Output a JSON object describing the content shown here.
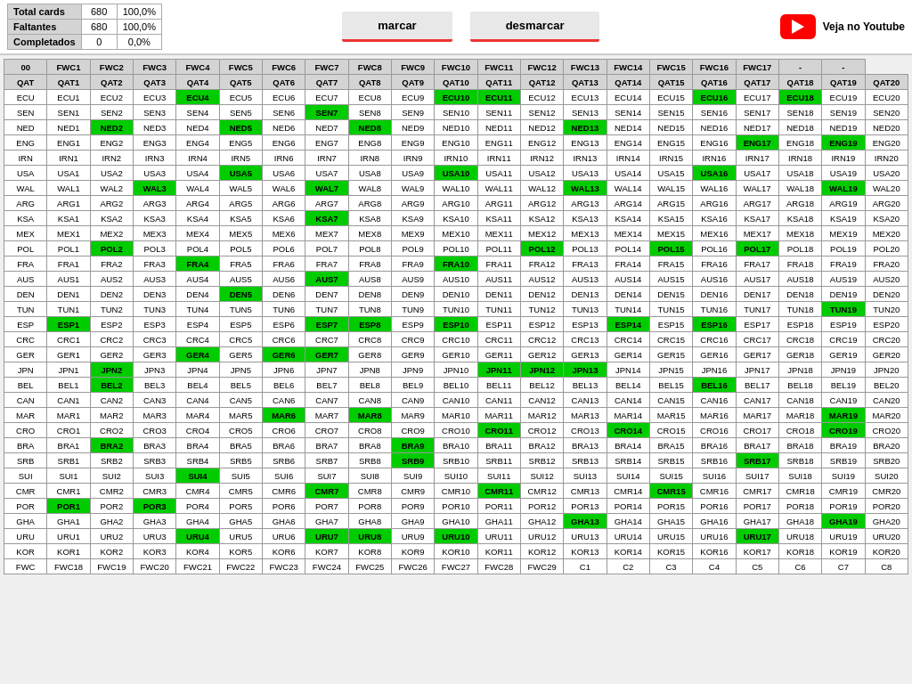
{
  "stats": {
    "total_label": "Total cards",
    "total_value": "680",
    "total_pct": "100,0%",
    "faltantes_label": "Faltantes",
    "faltantes_value": "680",
    "faltantes_pct": "100,0%",
    "completados_label": "Completados",
    "completados_value": "0",
    "completados_pct": "0,0%"
  },
  "buttons": {
    "marcar": "marcar",
    "desmarcar": "desmarcar"
  },
  "youtube": {
    "label": "Veja no Youtube"
  },
  "grid": {
    "headers": [
      "00",
      "FWC1",
      "FWC2",
      "FWC3",
      "FWC4",
      "FWC5",
      "FWC6",
      "FWC7",
      "FWC8",
      "FWC9",
      "FWC10",
      "FWC11",
      "FWC12",
      "FWC13",
      "FWC14",
      "FWC15",
      "FWC16",
      "FWC17",
      "-",
      "-"
    ],
    "rows": [
      {
        "prefix": "QAT",
        "cells": [
          "QAT1",
          "QAT2",
          "QAT3",
          "QAT4",
          "QAT5",
          "QAT6",
          "QAT7",
          "QAT8",
          "QAT9",
          "QAT10",
          "QAT11",
          "QAT12",
          "QAT13",
          "QAT14",
          "QAT15",
          "QAT16",
          "QAT17",
          "QAT18",
          "QAT19",
          "QAT20"
        ],
        "green": [
          13
        ]
      },
      {
        "prefix": "ECU",
        "cells": [
          "ECU1",
          "ECU2",
          "ECU3",
          "ECU4",
          "ECU5",
          "ECU6",
          "ECU7",
          "ECU8",
          "ECU9",
          "ECU10",
          "ECU11",
          "ECU12",
          "ECU13",
          "ECU14",
          "ECU15",
          "ECU16",
          "ECU17",
          "ECU18",
          "ECU19",
          "ECU20"
        ],
        "green": [
          3,
          9,
          10,
          15,
          17
        ]
      },
      {
        "prefix": "SEN",
        "cells": [
          "SEN1",
          "SEN2",
          "SEN3",
          "SEN4",
          "SEN5",
          "SEN6",
          "SEN7",
          "SEN8",
          "SEN9",
          "SEN10",
          "SEN11",
          "SEN12",
          "SEN13",
          "SEN14",
          "SEN15",
          "SEN16",
          "SEN17",
          "SEN18",
          "SEN19",
          "SEN20"
        ],
        "green": [
          6
        ]
      },
      {
        "prefix": "NED",
        "cells": [
          "NED1",
          "NED2",
          "NED3",
          "NED4",
          "NED5",
          "NED6",
          "NED7",
          "NED8",
          "NED9",
          "NED10",
          "NED11",
          "NED12",
          "NED13",
          "NED14",
          "NED15",
          "NED16",
          "NED17",
          "NED18",
          "NED19",
          "NED20"
        ],
        "green": [
          1,
          4,
          7,
          12
        ]
      },
      {
        "prefix": "ENG",
        "cells": [
          "ENG1",
          "ENG2",
          "ENG3",
          "ENG4",
          "ENG5",
          "ENG6",
          "ENG7",
          "ENG8",
          "ENG9",
          "ENG10",
          "ENG11",
          "ENG12",
          "ENG13",
          "ENG14",
          "ENG15",
          "ENG16",
          "ENG17",
          "ENG18",
          "ENG19",
          "ENG20"
        ],
        "green": [
          16,
          18
        ]
      },
      {
        "prefix": "IRN",
        "cells": [
          "IRN1",
          "IRN2",
          "IRN3",
          "IRN4",
          "IRN5",
          "IRN6",
          "IRN7",
          "IRN8",
          "IRN9",
          "IRN10",
          "IRN11",
          "IRN12",
          "IRN13",
          "IRN14",
          "IRN15",
          "IRN16",
          "IRN17",
          "IRN18",
          "IRN19",
          "IRN20"
        ],
        "green": []
      },
      {
        "prefix": "USA",
        "cells": [
          "USA1",
          "USA2",
          "USA3",
          "USA4",
          "USA5",
          "USA6",
          "USA7",
          "USA8",
          "USA9",
          "USA10",
          "USA11",
          "USA12",
          "USA13",
          "USA14",
          "USA15",
          "USA16",
          "USA17",
          "USA18",
          "USA19",
          "USA20"
        ],
        "green": [
          4,
          9,
          15
        ]
      },
      {
        "prefix": "WAL",
        "cells": [
          "WAL1",
          "WAL2",
          "WAL3",
          "WAL4",
          "WAL5",
          "WAL6",
          "WAL7",
          "WAL8",
          "WAL9",
          "WAL10",
          "WAL11",
          "WAL12",
          "WAL13",
          "WAL14",
          "WAL15",
          "WAL16",
          "WAL17",
          "WAL18",
          "WAL19",
          "WAL20"
        ],
        "green": [
          2,
          6,
          12,
          18
        ]
      },
      {
        "prefix": "ARG",
        "cells": [
          "ARG1",
          "ARG2",
          "ARG3",
          "ARG4",
          "ARG5",
          "ARG6",
          "ARG7",
          "ARG8",
          "ARG9",
          "ARG10",
          "ARG11",
          "ARG12",
          "ARG13",
          "ARG14",
          "ARG15",
          "ARG16",
          "ARG17",
          "ARG18",
          "ARG19",
          "ARG20"
        ],
        "green": []
      },
      {
        "prefix": "KSA",
        "cells": [
          "KSA1",
          "KSA2",
          "KSA3",
          "KSA4",
          "KSA5",
          "KSA6",
          "KSA7",
          "KSA8",
          "KSA9",
          "KSA10",
          "KSA11",
          "KSA12",
          "KSA13",
          "KSA14",
          "KSA15",
          "KSA16",
          "KSA17",
          "KSA18",
          "KSA19",
          "KSA20"
        ],
        "green": [
          6
        ]
      },
      {
        "prefix": "MEX",
        "cells": [
          "MEX1",
          "MEX2",
          "MEX3",
          "MEX4",
          "MEX5",
          "MEX6",
          "MEX7",
          "MEX8",
          "MEX9",
          "MEX10",
          "MEX11",
          "MEX12",
          "MEX13",
          "MEX14",
          "MEX15",
          "MEX16",
          "MEX17",
          "MEX18",
          "MEX19",
          "MEX20"
        ],
        "green": []
      },
      {
        "prefix": "POL",
        "cells": [
          "POL1",
          "POL2",
          "POL3",
          "POL4",
          "POL5",
          "POL6",
          "POL7",
          "POL8",
          "POL9",
          "POL10",
          "POL11",
          "POL12",
          "POL13",
          "POL14",
          "POL15",
          "POL16",
          "POL17",
          "POL18",
          "POL19",
          "POL20"
        ],
        "green": [
          1,
          11,
          14,
          16
        ]
      },
      {
        "prefix": "FRA",
        "cells": [
          "FRA1",
          "FRA2",
          "FRA3",
          "FRA4",
          "FRA5",
          "FRA6",
          "FRA7",
          "FRA8",
          "FRA9",
          "FRA10",
          "FRA11",
          "FRA12",
          "FRA13",
          "FRA14",
          "FRA15",
          "FRA16",
          "FRA17",
          "FRA18",
          "FRA19",
          "FRA20"
        ],
        "green": [
          3,
          9
        ]
      },
      {
        "prefix": "AUS",
        "cells": [
          "AUS1",
          "AUS2",
          "AUS3",
          "AUS4",
          "AUS5",
          "AUS6",
          "AUS7",
          "AUS8",
          "AUS9",
          "AUS10",
          "AUS11",
          "AUS12",
          "AUS13",
          "AUS14",
          "AUS15",
          "AUS16",
          "AUS17",
          "AUS18",
          "AUS19",
          "AUS20"
        ],
        "green": [
          6
        ]
      },
      {
        "prefix": "DEN",
        "cells": [
          "DEN1",
          "DEN2",
          "DEN3",
          "DEN4",
          "DEN5",
          "DEN6",
          "DEN7",
          "DEN8",
          "DEN9",
          "DEN10",
          "DEN11",
          "DEN12",
          "DEN13",
          "DEN14",
          "DEN15",
          "DEN16",
          "DEN17",
          "DEN18",
          "DEN19",
          "DEN20"
        ],
        "green": [
          4
        ]
      },
      {
        "prefix": "TUN",
        "cells": [
          "TUN1",
          "TUN2",
          "TUN3",
          "TUN4",
          "TUN5",
          "TUN6",
          "TUN7",
          "TUN8",
          "TUN9",
          "TUN10",
          "TUN11",
          "TUN12",
          "TUN13",
          "TUN14",
          "TUN15",
          "TUN16",
          "TUN17",
          "TUN18",
          "TUN19",
          "TUN20"
        ],
        "green": [
          18
        ]
      },
      {
        "prefix": "ESP",
        "cells": [
          "ESP1",
          "ESP2",
          "ESP3",
          "ESP4",
          "ESP5",
          "ESP6",
          "ESP7",
          "ESP8",
          "ESP9",
          "ESP10",
          "ESP11",
          "ESP12",
          "ESP13",
          "ESP14",
          "ESP15",
          "ESP16",
          "ESP17",
          "ESP18",
          "ESP19",
          "ESP20"
        ],
        "green": [
          0,
          6,
          7,
          9,
          13,
          15
        ]
      },
      {
        "prefix": "CRC",
        "cells": [
          "CRC1",
          "CRC2",
          "CRC3",
          "CRC4",
          "CRC5",
          "CRC6",
          "CRC7",
          "CRC8",
          "CRC9",
          "CRC10",
          "CRC11",
          "CRC12",
          "CRC13",
          "CRC14",
          "CRC15",
          "CRC16",
          "CRC17",
          "CRC18",
          "CRC19",
          "CRC20"
        ],
        "green": []
      },
      {
        "prefix": "GER",
        "cells": [
          "GER1",
          "GER2",
          "GER3",
          "GER4",
          "GER5",
          "GER6",
          "GER7",
          "GER8",
          "GER9",
          "GER10",
          "GER11",
          "GER12",
          "GER13",
          "GER14",
          "GER15",
          "GER16",
          "GER17",
          "GER18",
          "GER19",
          "GER20"
        ],
        "green": [
          3,
          5,
          6
        ]
      },
      {
        "prefix": "JPN",
        "cells": [
          "JPN1",
          "JPN2",
          "JPN3",
          "JPN4",
          "JPN5",
          "JPN6",
          "JPN7",
          "JPN8",
          "JPN9",
          "JPN10",
          "JPN11",
          "JPN12",
          "JPN13",
          "JPN14",
          "JPN15",
          "JPN16",
          "JPN17",
          "JPN18",
          "JPN19",
          "JPN20"
        ],
        "green": [
          1,
          10,
          11,
          12
        ]
      },
      {
        "prefix": "BEL",
        "cells": [
          "BEL1",
          "BEL2",
          "BEL3",
          "BEL4",
          "BEL5",
          "BEL6",
          "BEL7",
          "BEL8",
          "BEL9",
          "BEL10",
          "BEL11",
          "BEL12",
          "BEL13",
          "BEL14",
          "BEL15",
          "BEL16",
          "BEL17",
          "BEL18",
          "BEL19",
          "BEL20"
        ],
        "green": [
          1,
          15
        ]
      },
      {
        "prefix": "CAN",
        "cells": [
          "CAN1",
          "CAN2",
          "CAN3",
          "CAN4",
          "CAN5",
          "CAN6",
          "CAN7",
          "CAN8",
          "CAN9",
          "CAN10",
          "CAN11",
          "CAN12",
          "CAN13",
          "CAN14",
          "CAN15",
          "CAN16",
          "CAN17",
          "CAN18",
          "CAN19",
          "CAN20"
        ],
        "green": []
      },
      {
        "prefix": "MAR",
        "cells": [
          "MAR1",
          "MAR2",
          "MAR3",
          "MAR4",
          "MAR5",
          "MAR6",
          "MAR7",
          "MAR8",
          "MAR9",
          "MAR10",
          "MAR11",
          "MAR12",
          "MAR13",
          "MAR14",
          "MAR15",
          "MAR16",
          "MAR17",
          "MAR18",
          "MAR19",
          "MAR20"
        ],
        "green": [
          5,
          7,
          18
        ]
      },
      {
        "prefix": "CRO",
        "cells": [
          "CRO1",
          "CRO2",
          "CRO3",
          "CRO4",
          "CRO5",
          "CRO6",
          "CRO7",
          "CRO8",
          "CRO9",
          "CRO10",
          "CRO11",
          "CRO12",
          "CRO13",
          "CRO14",
          "CRO15",
          "CRO16",
          "CRO17",
          "CRO18",
          "CRO19",
          "CRO20"
        ],
        "green": [
          10,
          13,
          18
        ]
      },
      {
        "prefix": "BRA",
        "cells": [
          "BRA1",
          "BRA2",
          "BRA3",
          "BRA4",
          "BRA5",
          "BRA6",
          "BRA7",
          "BRA8",
          "BRA9",
          "BRA10",
          "BRA11",
          "BRA12",
          "BRA13",
          "BRA14",
          "BRA15",
          "BRA16",
          "BRA17",
          "BRA18",
          "BRA19",
          "BRA20"
        ],
        "green": [
          1,
          8
        ]
      },
      {
        "prefix": "SRB",
        "cells": [
          "SRB1",
          "SRB2",
          "SRB3",
          "SRB4",
          "SRB5",
          "SRB6",
          "SRB7",
          "SRB8",
          "SRB9",
          "SRB10",
          "SRB11",
          "SRB12",
          "SRB13",
          "SRB14",
          "SRB15",
          "SRB16",
          "SRB17",
          "SRB18",
          "SRB19",
          "SRB20"
        ],
        "green": [
          8,
          16
        ]
      },
      {
        "prefix": "SUI",
        "cells": [
          "SUI1",
          "SUI2",
          "SUI3",
          "SUI4",
          "SUI5",
          "SUI6",
          "SUI7",
          "SUI8",
          "SUI9",
          "SUI10",
          "SUI11",
          "SUI12",
          "SUI13",
          "SUI14",
          "SUI15",
          "SUI16",
          "SUI17",
          "SUI18",
          "SUI19",
          "SUI20"
        ],
        "green": [
          3
        ]
      },
      {
        "prefix": "CMR",
        "cells": [
          "CMR1",
          "CMR2",
          "CMR3",
          "CMR4",
          "CMR5",
          "CMR6",
          "CMR7",
          "CMR8",
          "CMR9",
          "CMR10",
          "CMR11",
          "CMR12",
          "CMR13",
          "CMR14",
          "CMR15",
          "CMR16",
          "CMR17",
          "CMR18",
          "CMR19",
          "CMR20"
        ],
        "green": [
          6,
          10,
          14
        ]
      },
      {
        "prefix": "POR",
        "cells": [
          "POR1",
          "POR2",
          "POR3",
          "POR4",
          "POR5",
          "POR6",
          "POR7",
          "POR8",
          "POR9",
          "POR10",
          "POR11",
          "POR12",
          "POR13",
          "POR14",
          "POR15",
          "POR16",
          "POR17",
          "POR18",
          "POR19",
          "POR20"
        ],
        "green": [
          0,
          2
        ]
      },
      {
        "prefix": "GHA",
        "cells": [
          "GHA1",
          "GHA2",
          "GHA3",
          "GHA4",
          "GHA5",
          "GHA6",
          "GHA7",
          "GHA8",
          "GHA9",
          "GHA10",
          "GHA11",
          "GHA12",
          "GHA13",
          "GHA14",
          "GHA15",
          "GHA16",
          "GHA17",
          "GHA18",
          "GHA19",
          "GHA20"
        ],
        "green": [
          12,
          18
        ]
      },
      {
        "prefix": "URU",
        "cells": [
          "URU1",
          "URU2",
          "URU3",
          "URU4",
          "URU5",
          "URU6",
          "URU7",
          "URU8",
          "URU9",
          "URU10",
          "URU11",
          "URU12",
          "URU13",
          "URU14",
          "URU15",
          "URU16",
          "URU17",
          "URU18",
          "URU19",
          "URU20"
        ],
        "green": [
          3,
          6,
          7,
          9,
          16
        ]
      },
      {
        "prefix": "KOR",
        "cells": [
          "KOR1",
          "KOR2",
          "KOR3",
          "KOR4",
          "KOR5",
          "KOR6",
          "KOR7",
          "KOR8",
          "KOR9",
          "KOR10",
          "KOR11",
          "KOR12",
          "KOR13",
          "KOR14",
          "KOR15",
          "KOR16",
          "KOR17",
          "KOR18",
          "KOR19",
          "KOR20"
        ],
        "green": []
      },
      {
        "prefix": "FWC",
        "cells": [
          "FWC18",
          "FWC19",
          "FWC20",
          "FWC21",
          "FWC22",
          "FWC23",
          "FWC24",
          "FWC25",
          "FWC26",
          "FWC27",
          "FWC28",
          "FWC29",
          "C1",
          "C2",
          "C3",
          "C4",
          "C5",
          "C6",
          "C7",
          "C8"
        ],
        "green": []
      }
    ]
  }
}
